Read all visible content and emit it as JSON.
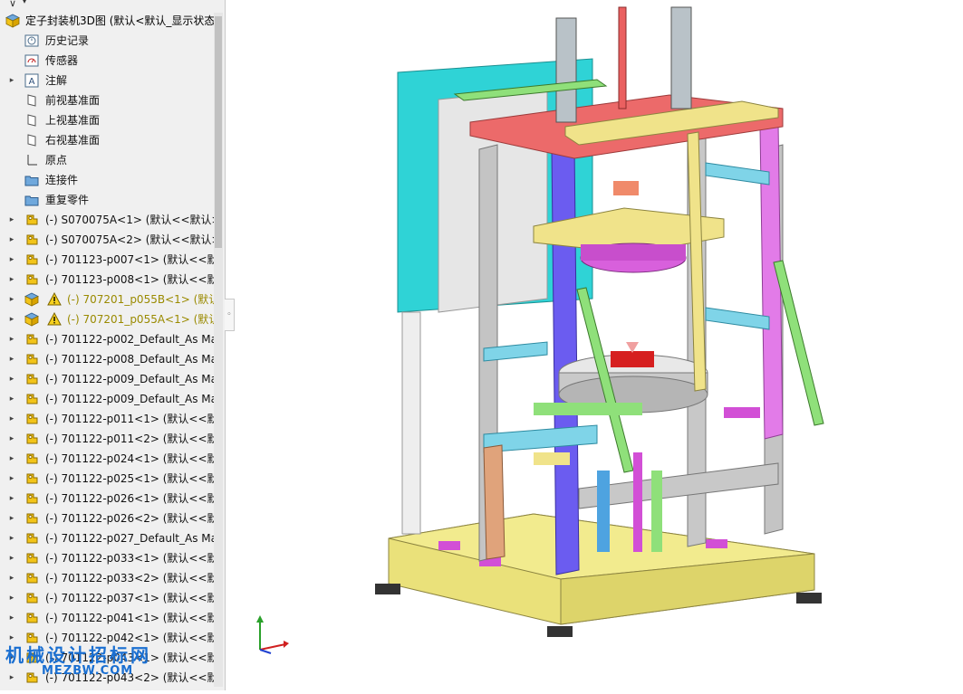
{
  "filter": {
    "icon": "funnel-icon"
  },
  "tree": {
    "root_label": "定子封装机3D图 (默认<默认_显示状态",
    "items": [
      {
        "label": "历史记录",
        "icon": "history-icon",
        "expandable": false
      },
      {
        "label": "传感器",
        "icon": "sensor-icon",
        "expandable": false
      },
      {
        "label": "注解",
        "icon": "annotation-icon",
        "expandable": true
      },
      {
        "label": "前视基准面",
        "icon": "plane-icon",
        "expandable": false
      },
      {
        "label": "上视基准面",
        "icon": "plane-icon",
        "expandable": false
      },
      {
        "label": "右视基准面",
        "icon": "plane-icon",
        "expandable": false
      },
      {
        "label": "原点",
        "icon": "origin-icon",
        "expandable": false
      },
      {
        "label": "连接件",
        "icon": "folder-icon",
        "expandable": false
      },
      {
        "label": "重复零件",
        "icon": "folder-icon",
        "expandable": false
      },
      {
        "label": "(-) S070075A<1> (默认<<默认>",
        "icon": "part-icon",
        "expandable": true
      },
      {
        "label": "(-) S070075A<2> (默认<<默认>",
        "icon": "part-icon",
        "expandable": true
      },
      {
        "label": "(-) 701123-p007<1> (默认<<默认",
        "icon": "part-icon",
        "expandable": true
      },
      {
        "label": "(-) 701123-p008<1> (默认<<默认",
        "icon": "part-icon",
        "expandable": true
      },
      {
        "label": "(-) 707201_p055B<1> (默认",
        "icon": "assembly-warning-icon",
        "expandable": true,
        "warning": true
      },
      {
        "label": "(-) 707201_p055A<1> (默认",
        "icon": "assembly-warning-icon",
        "expandable": true,
        "warning": true
      },
      {
        "label": "(-) 701122-p002_Default_As Ma",
        "icon": "part-icon",
        "expandable": true
      },
      {
        "label": "(-) 701122-p008_Default_As Ma",
        "icon": "part-icon",
        "expandable": true
      },
      {
        "label": "(-) 701122-p009_Default_As Ma",
        "icon": "part-icon",
        "expandable": true
      },
      {
        "label": "(-) 701122-p009_Default_As Ma",
        "icon": "part-icon",
        "expandable": true
      },
      {
        "label": "(-) 701122-p011<1> (默认<<默",
        "icon": "part-icon",
        "expandable": true
      },
      {
        "label": "(-) 701122-p011<2> (默认<<默",
        "icon": "part-icon",
        "expandable": true
      },
      {
        "label": "(-) 701122-p024<1> (默认<<默",
        "icon": "part-icon",
        "expandable": true
      },
      {
        "label": "(-) 701122-p025<1> (默认<<默",
        "icon": "part-icon",
        "expandable": true
      },
      {
        "label": "(-) 701122-p026<1> (默认<<默",
        "icon": "part-icon",
        "expandable": true
      },
      {
        "label": "(-) 701122-p026<2> (默认<<默",
        "icon": "part-icon",
        "expandable": true
      },
      {
        "label": "(-) 701122-p027_Default_As Ma",
        "icon": "part-icon",
        "expandable": true
      },
      {
        "label": "(-) 701122-p033<1> (默认<<默",
        "icon": "part-icon",
        "expandable": true
      },
      {
        "label": "(-) 701122-p033<2> (默认<<默",
        "icon": "part-icon",
        "expandable": true
      },
      {
        "label": "(-) 701122-p037<1> (默认<<默",
        "icon": "part-icon",
        "expandable": true
      },
      {
        "label": "(-) 701122-p041<1> (默认<<默",
        "icon": "part-icon",
        "expandable": true
      },
      {
        "label": "(-) 701122-p042<1> (默认<<默",
        "icon": "part-icon",
        "expandable": true
      },
      {
        "label": "(-) 701122-p043<1> (默认<<默",
        "icon": "part-icon",
        "expandable": true
      },
      {
        "label": "(-) 701122-p043<2> (默认<<默",
        "icon": "part-icon",
        "expandable": true
      }
    ]
  },
  "viewport": {
    "model": "stator-encapsulation-machine-3d",
    "triad": "xyz-triad-icon"
  },
  "watermark": {
    "line1": "机械设计招标网",
    "line2": "MEZBW.COM"
  },
  "colors": {
    "panel_bg": "#f0f0f0",
    "part_icon": "#f2c419",
    "warning": "#9a8a00",
    "watermark": "#1a6fd1"
  }
}
